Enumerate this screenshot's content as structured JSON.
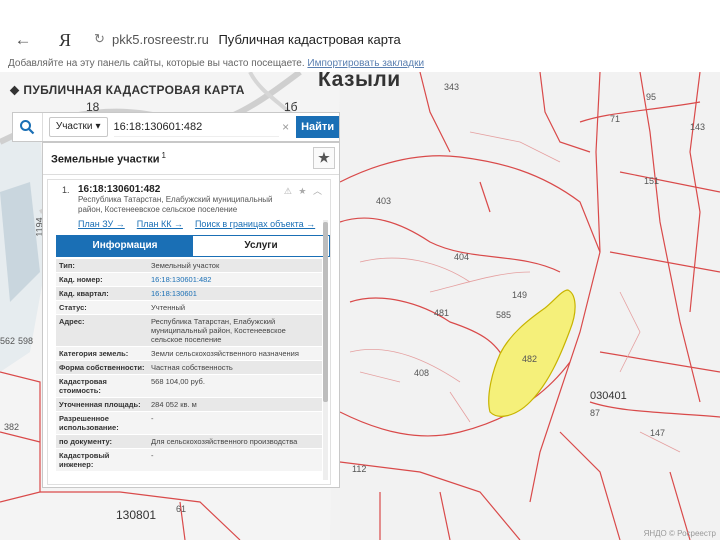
{
  "browser": {
    "back_glyph": "←",
    "yandex_glyph": "Я",
    "reload_glyph": "↻",
    "host": "pkk5.rosreestr.ru",
    "page_title": "Публичная кадастровая карта",
    "bookmarks_prompt": "Добавляйте на эту панель сайты, которые вы часто посещаете.",
    "bookmarks_link": "Импортировать закладки"
  },
  "app": {
    "logo_glyph": "⬥",
    "title": "ПУБЛИЧНАЯ КАДАСТРОВАЯ КАРТА"
  },
  "search": {
    "type_label": "Участки",
    "type_caret": "▾",
    "value": "16:18:130601:482",
    "clear_glyph": "×",
    "button_label": "Найти"
  },
  "results": {
    "heading": "Земельные участки",
    "count": "1",
    "star_glyph": "★",
    "item": {
      "index": "1.",
      "cadastral_number": "16:18:130601:482",
      "address": "Республика Татарстан, Елабужский муниципальный район, Костенеевское сельское поселение",
      "icons": "⚠ ★ ︿",
      "links": [
        "План ЗУ →",
        "План КК →",
        "Поиск в границах объекта →"
      ]
    },
    "tabs": [
      {
        "label": "Информация",
        "active": true
      },
      {
        "label": "Услуги",
        "active": false
      }
    ],
    "rows": [
      {
        "key": "Тип:",
        "value": "Земельный участок"
      },
      {
        "key": "Кад. номер:",
        "value": "16:18:130601:482"
      },
      {
        "key": "Кад. квартал:",
        "value": "16:18:130601"
      },
      {
        "key": "Статус:",
        "value": "Учтенный"
      },
      {
        "key": "Адрес:",
        "value": "Республика Татарстан, Елабужский муниципальный район, Костенеевское сельское поселение"
      },
      {
        "key": "Категория земель:",
        "value": "Земли сельскохозяйственного назначения"
      },
      {
        "key": "Форма собственности:",
        "value": "Частная собственность"
      },
      {
        "key": "Кадастровая стоимость:",
        "value": "568 104,00 руб."
      },
      {
        "key": "Уточненная площадь:",
        "value": "284 052 кв. м"
      },
      {
        "key": "Разрешенное использование:",
        "value": "-"
      },
      {
        "key": "по документу:",
        "value": "Для сельскохозяйственного производства"
      },
      {
        "key": "Кадастровый инженер:",
        "value": "-"
      }
    ]
  },
  "map": {
    "place_name": "Казыли",
    "highlight_color": "#f5f07a",
    "boundary_color": "#e05050",
    "labels": {
      "l343": "343",
      "l71": "71",
      "l151": "151",
      "l403": "403",
      "l404": "404",
      "l149": "149",
      "l481": "481",
      "l585": "585",
      "l482": "482",
      "l408": "408",
      "l030401": "030401",
      "l87": "87",
      "l147": "147",
      "l112": "112",
      "l130801": "130801",
      "l382": "382",
      "l562": "562",
      "l598": "598",
      "l18": "18",
      "l16": "1б",
      "l1194": "1194",
      "l61": "61",
      "l95": "95",
      "l143": "143"
    },
    "attribution": "ЯНДО © Росреестр"
  }
}
